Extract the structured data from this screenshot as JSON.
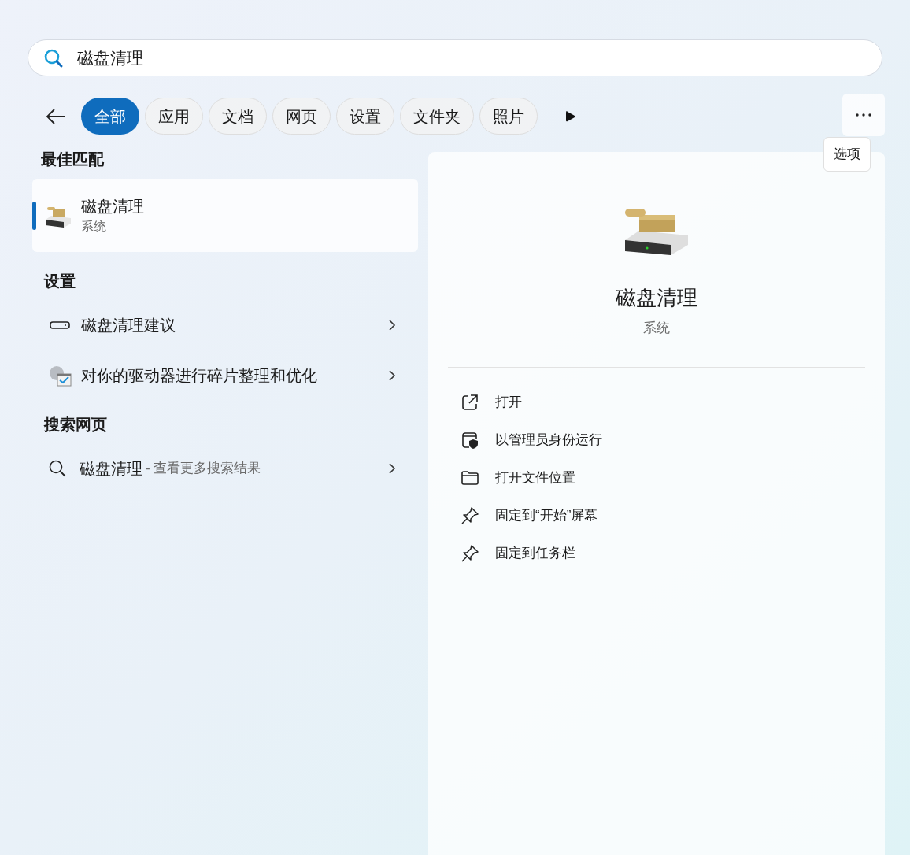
{
  "search": {
    "value": "磁盘清理"
  },
  "filters": [
    {
      "label": "全部",
      "selected": true
    },
    {
      "label": "应用",
      "selected": false
    },
    {
      "label": "文档",
      "selected": false
    },
    {
      "label": "网页",
      "selected": false
    },
    {
      "label": "设置",
      "selected": false
    },
    {
      "label": "文件夹",
      "selected": false
    },
    {
      "label": "照片",
      "selected": false
    }
  ],
  "more_tooltip": "选项",
  "best_match": {
    "heading": "最佳匹配",
    "item": {
      "title": "磁盘清理",
      "subtitle": "系统",
      "selected": true
    }
  },
  "settings": {
    "heading": "设置",
    "items": [
      {
        "kind": "drive",
        "label": "磁盘清理建议"
      },
      {
        "kind": "defrag",
        "label": "对你的驱动器进行碎片整理和优化"
      }
    ]
  },
  "web": {
    "heading": "搜索网页",
    "item": {
      "query": "磁盘清理",
      "hint": "- 查看更多搜索结果"
    }
  },
  "detail": {
    "title": "磁盘清理",
    "subtitle": "系统",
    "actions": [
      {
        "kind": "open",
        "label": "打开"
      },
      {
        "kind": "admin",
        "label": "以管理员身份运行"
      },
      {
        "kind": "folder",
        "label": "打开文件位置"
      },
      {
        "kind": "pin",
        "label": "固定到“开始”屏幕"
      },
      {
        "kind": "pin",
        "label": "固定到任务栏"
      }
    ]
  }
}
